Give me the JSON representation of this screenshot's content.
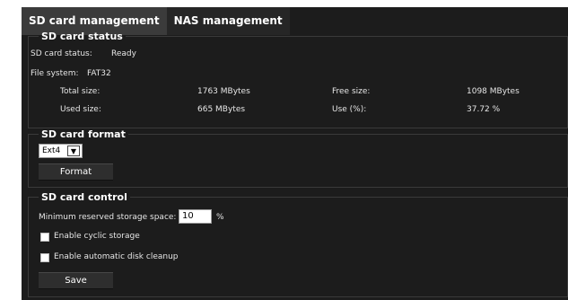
{
  "tabs": [
    {
      "label": "SD card management",
      "active": true
    },
    {
      "label": "NAS management",
      "active": false
    }
  ],
  "status": {
    "legend": "SD card status",
    "sd_status_label": "SD card status:",
    "sd_status_value": "Ready",
    "fs_label": "File system:",
    "fs_value": "FAT32",
    "total_label": "Total size:",
    "total_value": "1763 MBytes",
    "free_label": "Free size:",
    "free_value": "1098 MBytes",
    "used_label": "Used size:",
    "used_value": "665 MBytes",
    "use_label": "Use (%):",
    "use_value": "37.72 %"
  },
  "format": {
    "legend": "SD card format",
    "select_value": "Ext4",
    "button_label": "Format"
  },
  "control": {
    "legend": "SD card control",
    "reserved_label": "Minimum reserved storage space:",
    "reserved_value": "10",
    "reserved_unit": "%",
    "cyclic_label": "Enable cyclic storage",
    "cleanup_label": "Enable automatic disk cleanup",
    "save_label": "Save"
  },
  "colors": {
    "panel_bg": "#1c1c1c",
    "active_tab_bg": "#3b3b3b"
  }
}
